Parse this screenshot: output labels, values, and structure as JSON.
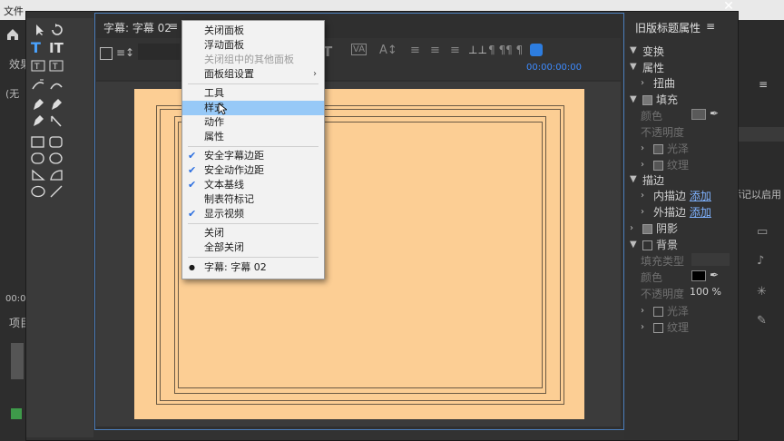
{
  "background": {
    "file_menu": "文件",
    "left_items": [
      "效果",
      "(无",
      "00:0",
      "项目"
    ],
    "right_text": "标记以启用"
  },
  "canvas": {
    "tab_label": "字幕: 字幕 02",
    "menu_icon": "≡",
    "timecode": "00:00:00:00"
  },
  "properties": {
    "title": "旧版标题属性",
    "menu_icon": "≡",
    "sections": {
      "transform": "变换",
      "attributes": "属性",
      "distort": "扭曲",
      "fill": "填充",
      "fill_color": "颜色",
      "fill_opacity": "不透明度",
      "sheen": "光泽",
      "texture": "纹理",
      "strokes": "描边",
      "inner_stroke": "内描边",
      "outer_stroke": "外描边",
      "add": "添加",
      "shadow": "阴影",
      "background": "背景",
      "fill_type": "填充类型",
      "bg_color": "颜色",
      "bg_opacity": "不透明度",
      "bg_opacity_value": "100 %",
      "bg_sheen": "光泽",
      "bg_texture": "纹理"
    }
  },
  "context_menu": {
    "group1": [
      {
        "label": "关闭面板",
        "disabled": false
      },
      {
        "label": "浮动面板",
        "disabled": false
      },
      {
        "label": "关闭组中的其他面板",
        "disabled": true
      },
      {
        "label": "面板组设置",
        "disabled": false,
        "submenu": true
      }
    ],
    "group2": [
      {
        "label": "工具"
      },
      {
        "label": "样式",
        "highlighted": true
      },
      {
        "label": "动作"
      },
      {
        "label": "属性"
      }
    ],
    "group3": [
      {
        "label": "安全字幕边距",
        "checked": true
      },
      {
        "label": "安全动作边距",
        "checked": true
      },
      {
        "label": "文本基线",
        "checked": true
      },
      {
        "label": "制表符标记",
        "checked": false
      },
      {
        "label": "显示视频",
        "checked": true
      }
    ],
    "group4": [
      {
        "label": "关闭"
      },
      {
        "label": "全部关闭"
      }
    ],
    "group5": [
      {
        "label": "字幕: 字幕 02",
        "bullet": true
      }
    ],
    "check_glyph": "✔",
    "bullet_glyph": "●",
    "submenu_glyph": "›"
  },
  "colors": {
    "video_background": "#fcce94",
    "highlight": "#97c9f7",
    "accent": "#3d8bff"
  }
}
